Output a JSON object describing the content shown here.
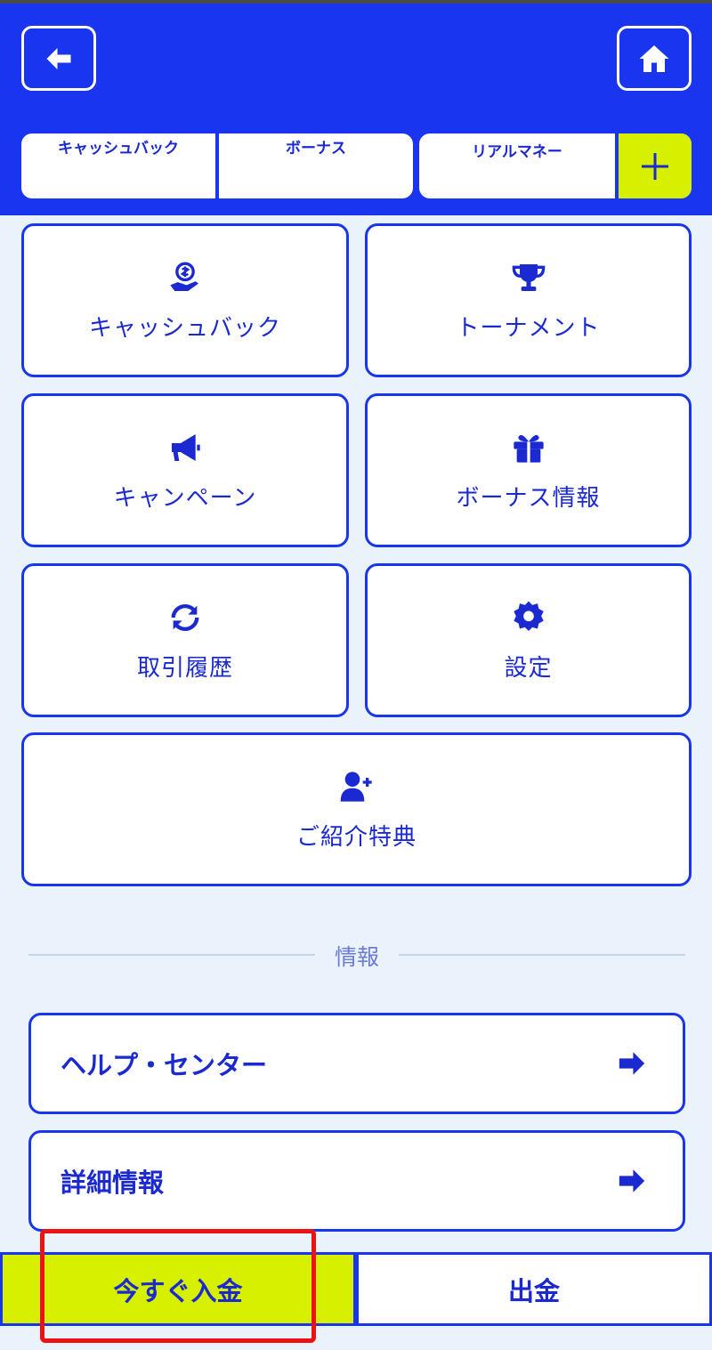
{
  "colors": {
    "brand_blue": "#1a35f0",
    "accent_lime": "#d6f000",
    "background": "#eaf3fb",
    "text_blue": "#1a2ad0",
    "highlight_red": "#ee1111"
  },
  "header": {
    "back_icon": "arrow-left-icon",
    "home_icon": "home-icon"
  },
  "wallets": [
    {
      "label": "キャッシュバック"
    },
    {
      "label": "ボーナス"
    },
    {
      "label": "リアルマネー"
    }
  ],
  "wallet_add_icon": "plus-icon",
  "menu": [
    {
      "label": "キャッシュバック",
      "icon": "cashback-hand-dollar-icon"
    },
    {
      "label": "トーナメント",
      "icon": "trophy-icon"
    },
    {
      "label": "キャンペーン",
      "icon": "megaphone-icon"
    },
    {
      "label": "ボーナス情報",
      "icon": "gift-icon"
    },
    {
      "label": "取引履歴",
      "icon": "refresh-arrows-icon"
    },
    {
      "label": "設定",
      "icon": "gear-icon"
    },
    {
      "label": "ご紹介特典",
      "icon": "add-user-icon"
    }
  ],
  "info_section": {
    "title": "情報",
    "items": [
      {
        "label": "ヘルプ・センター",
        "icon": "arrow-right-icon"
      },
      {
        "label": "詳細情報",
        "icon": "arrow-right-icon"
      }
    ]
  },
  "bottom": {
    "deposit_label": "今すぐ入金",
    "withdraw_label": "出金"
  }
}
